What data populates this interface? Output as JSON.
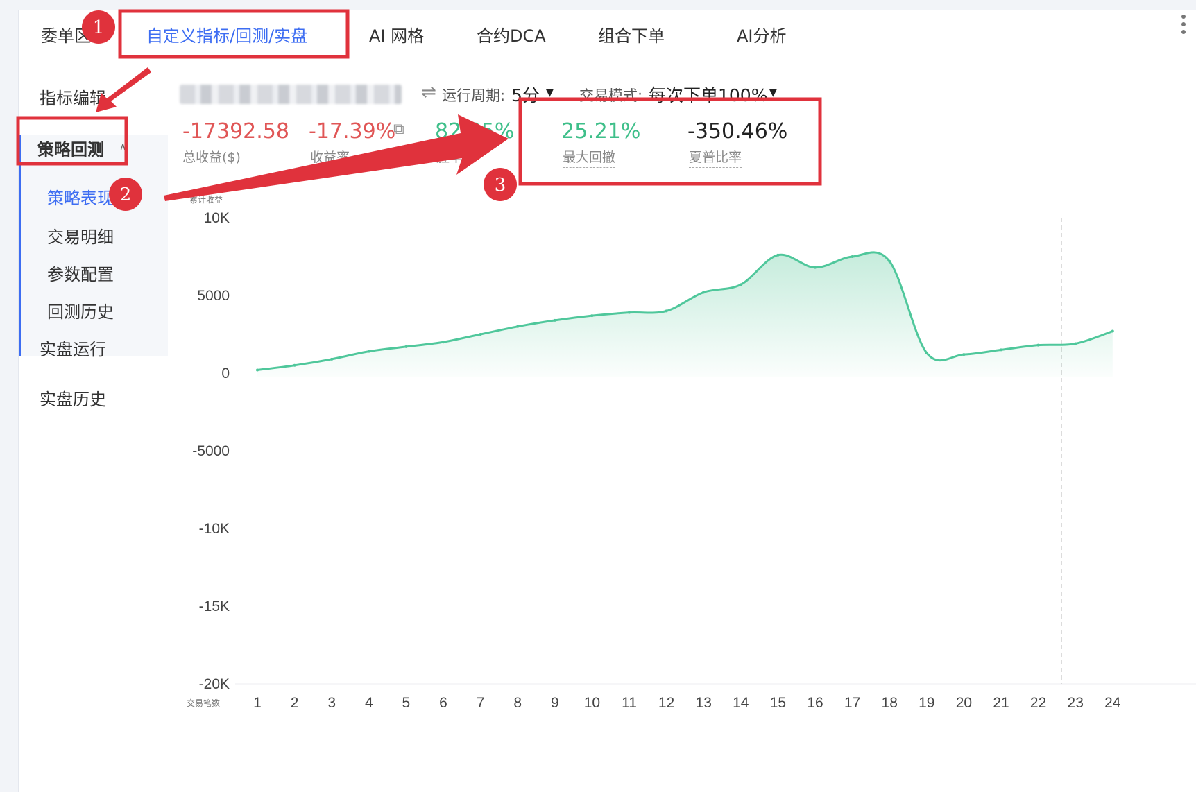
{
  "tabs": [
    {
      "label": "委单区"
    },
    {
      "label": "自定义指标/回测/实盘"
    },
    {
      "label": "AI 网格"
    },
    {
      "label": "合约DCA"
    },
    {
      "label": "组合下单"
    },
    {
      "label": "AI分析"
    }
  ],
  "sidebar": {
    "indicator_edit": "指标编辑",
    "backtest": "策略回测",
    "sub_items": [
      "策略表现",
      "交易明细",
      "参数配置",
      "回测历史"
    ],
    "live_run": "实盘运行",
    "live_history": "实盘历史"
  },
  "options": {
    "period_label": "运行周期:",
    "period_value": "5分",
    "mode_label": "交易模式:",
    "mode_value": "每次下单100%"
  },
  "metrics": {
    "total_profit": {
      "value": "-17392.58",
      "label": "总收益($)"
    },
    "profit_rate": {
      "value": "-17.39%",
      "label": "收益率"
    },
    "win_rate": {
      "value": "82.35%",
      "label": "胜率"
    },
    "max_drawdown": {
      "value": "25.21%",
      "label": "最大回撤"
    },
    "sharpe": {
      "value": "-350.46%",
      "label": "夏普比率"
    }
  },
  "annotations": {
    "badge1": "1",
    "badge2": "2",
    "badge3": "3"
  },
  "colors": {
    "accent": "#3d6df2",
    "loss": "#e05656",
    "gain": "#3fbf8a",
    "highlight": "#e0323c"
  },
  "chart_data": {
    "type": "area",
    "ylabel": "累计收益",
    "xlabel": "交易笔数",
    "yticks": [
      "10K",
      "5000",
      "0",
      "-5000",
      "-10K",
      "-15K",
      "-20K"
    ],
    "ylim": [
      -20000,
      10000
    ],
    "x": [
      1,
      2,
      3,
      4,
      5,
      6,
      7,
      8,
      9,
      10,
      11,
      12,
      13,
      14,
      15,
      16,
      17,
      18,
      19,
      20,
      21,
      22,
      23,
      24
    ],
    "series": [
      {
        "values": [
          200,
          500,
          900,
          1400,
          1700,
          2000,
          2500,
          3000,
          3400,
          3700,
          3900,
          4000,
          5200,
          5700,
          7600,
          6800,
          7500,
          7200,
          1300,
          1200,
          1500,
          1800,
          1900,
          2700
        ]
      }
    ],
    "grid": false,
    "legend": "none"
  }
}
